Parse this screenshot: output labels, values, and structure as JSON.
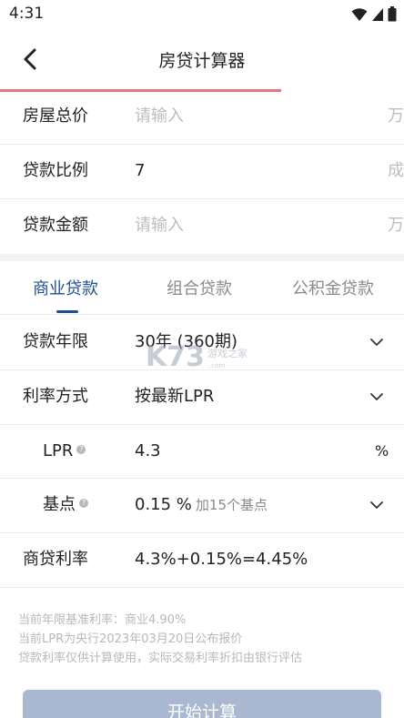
{
  "status_bar": {
    "time": "4:31"
  },
  "header": {
    "title": "房贷计算器"
  },
  "inputs": {
    "house_price": {
      "label": "房屋总价",
      "placeholder": "请输入",
      "unit": "万"
    },
    "loan_ratio": {
      "label": "贷款比例",
      "value": "7",
      "unit": "成"
    },
    "loan_amount": {
      "label": "贷款金额",
      "placeholder": "请输入",
      "unit": "万"
    }
  },
  "tabs": [
    {
      "label": "商业贷款",
      "active": true
    },
    {
      "label": "组合贷款",
      "active": false
    },
    {
      "label": "公积金贷款",
      "active": false
    }
  ],
  "loan_term": {
    "label": "贷款年限",
    "value": "30年 (360期)"
  },
  "rate_mode": {
    "label": "利率方式",
    "value": "按最新LPR"
  },
  "lpr": {
    "label": "LPR",
    "value": "4.3",
    "unit": "%"
  },
  "basis_point": {
    "label": "基点",
    "value": "0.15 %",
    "hint": "加15个基点"
  },
  "commercial_rate": {
    "label": "商贷利率",
    "value": "4.3%+0.15%=4.45%"
  },
  "notes": [
    "当前年限基准利率：商业4.90%",
    "当前LPR为央行2023年03月20日公布报价",
    "贷款利率仅供计算使用，实际交易利率折扣由银行评估"
  ],
  "start_button": {
    "label": "开始计算"
  },
  "colors": {
    "accent": "#1f4f8f",
    "title_underline": "#e8757c",
    "button_disabled": "#a9b8d0"
  }
}
